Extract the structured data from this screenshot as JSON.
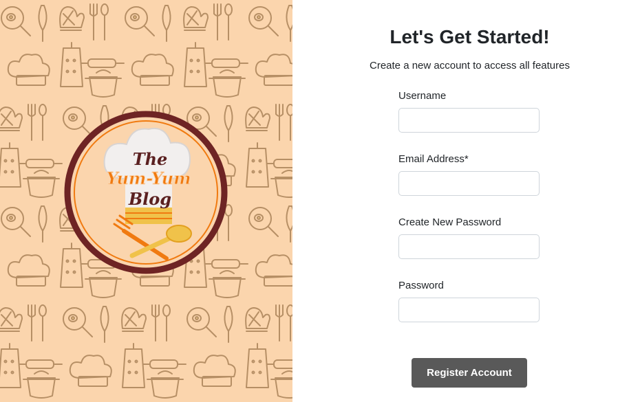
{
  "logo": {
    "text_line1": "The",
    "text_line2": "Yum-Yum",
    "text_line3": "Blog"
  },
  "form": {
    "title": "Let's Get Started!",
    "subtitle": "Create a new account to access all features",
    "fields": [
      {
        "label": "Username",
        "value": ""
      },
      {
        "label": "Email Address*",
        "value": ""
      },
      {
        "label": "Create New Password",
        "value": ""
      },
      {
        "label": "Password",
        "value": ""
      }
    ],
    "submit_label": "Register Account"
  },
  "colors": {
    "panel_background": "#fbd5ad",
    "doodle_stroke": "#a0784e",
    "logo_ring": "#6e2424",
    "logo_accent": "#f07a10",
    "button_background": "#595959"
  },
  "icons": [
    "whisk-icon",
    "oven-mitt-icon",
    "frying-pan-icon",
    "fork-icon",
    "spoon-icon",
    "chef-hat-icon",
    "grater-icon",
    "rolling-pin-icon",
    "pot-icon"
  ]
}
